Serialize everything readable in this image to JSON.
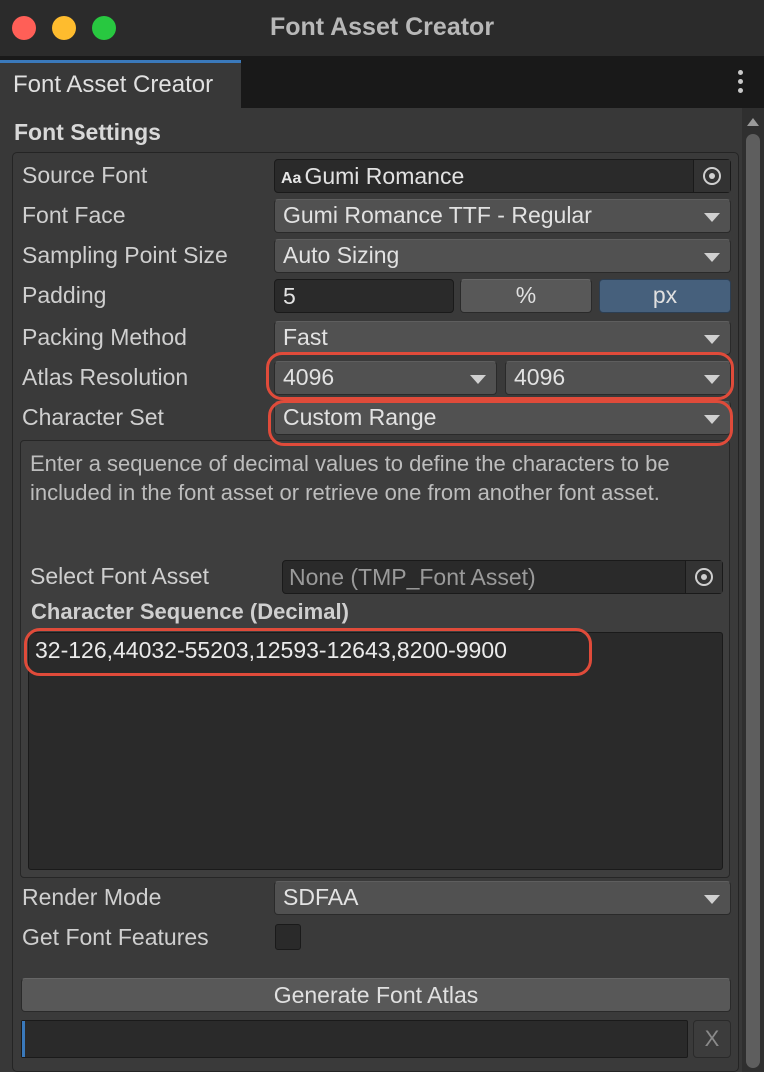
{
  "window": {
    "title": "Font Asset Creator"
  },
  "tab": {
    "label": "Font Asset Creator",
    "menu_icon": "kebab-menu-icon"
  },
  "section": {
    "title": "Font Settings"
  },
  "fields": {
    "source_font": {
      "label": "Source Font",
      "value": "Gumi Romance",
      "icon": "font-asset-icon"
    },
    "font_face": {
      "label": "Font Face",
      "value": "Gumi Romance TTF - Regular"
    },
    "sampling_point_size": {
      "label": "Sampling Point Size",
      "value": "Auto Sizing"
    },
    "padding": {
      "label": "Padding",
      "value": "5",
      "percent_label": "%",
      "px_label": "px",
      "selected_unit": "px"
    },
    "packing_method": {
      "label": "Packing Method",
      "value": "Fast"
    },
    "atlas_resolution": {
      "label": "Atlas Resolution",
      "width": "4096",
      "height": "4096"
    },
    "character_set": {
      "label": "Character Set",
      "value": "Custom Range"
    },
    "help_text": "Enter a sequence of decimal values to define the characters to be included in the font asset or retrieve one from another font asset.",
    "select_font_asset": {
      "label": "Select Font Asset",
      "value": "None (TMP_Font Asset)"
    },
    "character_sequence": {
      "label": "Character Sequence (Decimal)",
      "value": "32-126,44032-55203,12593-12643,8200-9900"
    },
    "render_mode": {
      "label": "Render Mode",
      "value": "SDFAA"
    },
    "get_font_features": {
      "label": "Get Font Features",
      "checked": false
    }
  },
  "actions": {
    "generate_label": "Generate Font Atlas",
    "cancel_label": "X",
    "progress": 0
  },
  "colors": {
    "accent": "#3a79bb",
    "highlight": "#e04b3a",
    "selected_unit": "#46607c"
  }
}
